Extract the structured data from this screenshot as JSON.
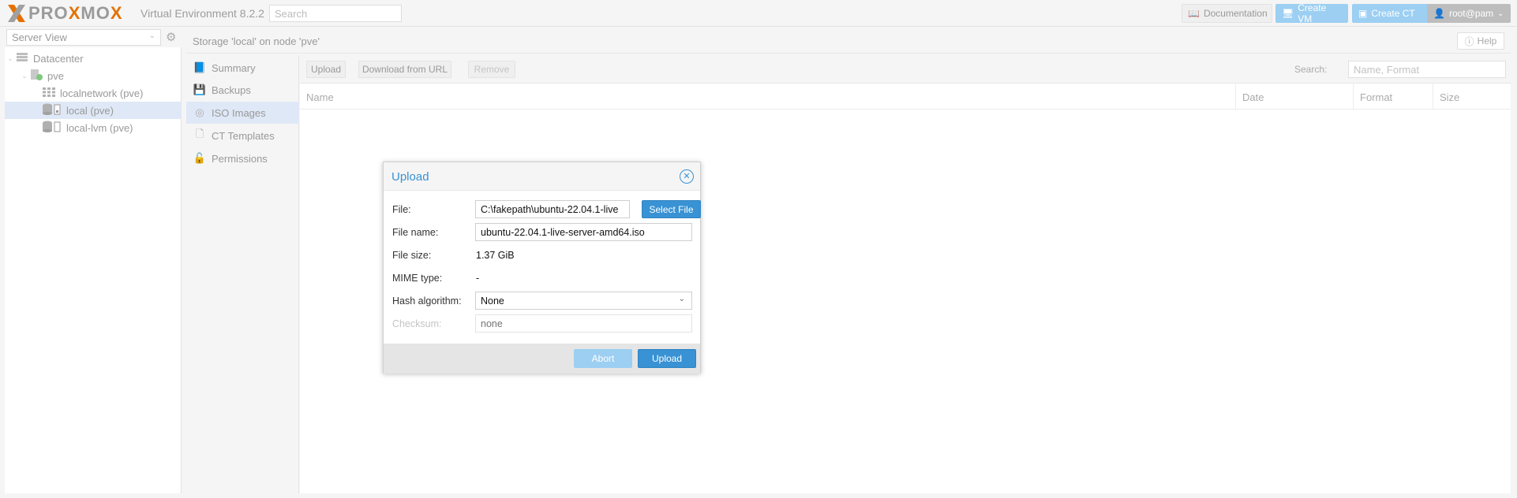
{
  "topbar": {
    "logo_prefix": "PRO",
    "logo_ox1": "X",
    "logo_mo": "MO",
    "logo_ox2": "X",
    "version": "Virtual Environment 8.2.2",
    "search_placeholder": "Search",
    "documentation_label": "Documentation",
    "create_vm_label": "Create VM",
    "create_ct_label": "Create CT",
    "user_label": "root@pam"
  },
  "left_panel": {
    "view_label": "Server View",
    "tree": [
      {
        "label": "Datacenter",
        "icon": "datacenter-icon"
      },
      {
        "label": "pve",
        "icon": "node-icon"
      },
      {
        "label": "localnetwork (pve)",
        "icon": "network-grid-icon"
      },
      {
        "label": "local (pve)",
        "icon": "storage-icon",
        "selected": true
      },
      {
        "label": "local-lvm (pve)",
        "icon": "storage-icon"
      }
    ]
  },
  "content": {
    "title": "Storage 'local' on node 'pve'",
    "help_label": "Help"
  },
  "submenu": {
    "items": [
      {
        "label": "Summary",
        "icon": "book-icon"
      },
      {
        "label": "Backups",
        "icon": "floppy-icon"
      },
      {
        "label": "ISO Images",
        "icon": "disc-icon",
        "active": true
      },
      {
        "label": "CT Templates",
        "icon": "template-icon"
      },
      {
        "label": "Permissions",
        "icon": "unlock-icon"
      }
    ]
  },
  "grid": {
    "upload_label": "Upload",
    "download_url_label": "Download from URL",
    "remove_label": "Remove",
    "search_label": "Search:",
    "search_placeholder": "Name, Format",
    "columns": [
      "Name",
      "Date",
      "Format",
      "Size"
    ]
  },
  "dialog": {
    "title": "Upload",
    "file_label": "File:",
    "file_value": "C:\\fakepath\\ubuntu-22.04.1-live",
    "select_file_label": "Select File",
    "filename_label": "File name:",
    "filename_value": "ubuntu-22.04.1-live-server-amd64.iso",
    "filesize_label": "File size:",
    "filesize_value": "1.37 GiB",
    "mime_label": "MIME type:",
    "mime_value": "-",
    "hash_label": "Hash algorithm:",
    "hash_value": "None",
    "checksum_label": "Checksum:",
    "checksum_placeholder": "none",
    "abort_label": "Abort",
    "upload_label": "Upload"
  },
  "colors": {
    "accent": "#3892d4",
    "accent_light": "#9ccff2",
    "logo_orange": "#e57000",
    "selected_row": "#dfe8f6"
  }
}
